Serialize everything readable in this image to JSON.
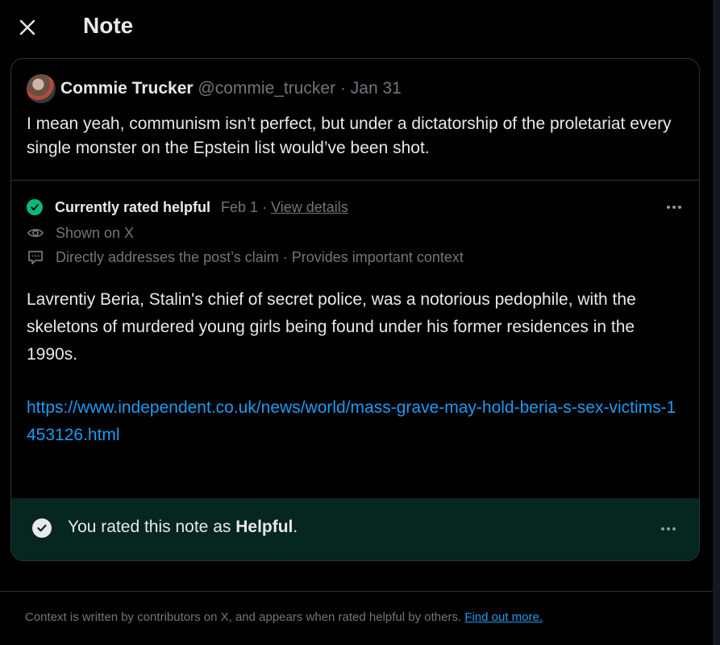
{
  "header": {
    "title": "Note",
    "close_icon": "close-icon"
  },
  "post": {
    "author": "Commie Trucker",
    "handle": "@commie_trucker",
    "separator": "·",
    "date": "Jan 31",
    "text": "I mean yeah, communism isn’t perfect, but under a dictatorship of the proletariat every single monster on the Epstein list would’ve been shot."
  },
  "note": {
    "status_label": "Currently rated helpful",
    "status_date": "Feb 1",
    "separator": "·",
    "view_details": "View details",
    "shown_on": "Shown on X",
    "reasons": "Directly addresses the post’s claim · Provides important context",
    "body": "Lavrentiy Beria, Stalin's chief of secret police, was a notorious pedophile, with the skeletons of murdered young girls being found under his former residences in the 1990s.",
    "link": "https://www.independent.co.uk/news/world/mass-grave-may-hold-beria-s-sex-victims-1453126.html",
    "status_color": "#00ba7c",
    "link_color": "#1d9bf0"
  },
  "rating": {
    "prefix": "You rated this note as ",
    "value": "Helpful",
    "suffix": ".",
    "bar_color": "#062620"
  },
  "footer": {
    "text": "Context is written by contributors on X, and appears when rated helpful by others. ",
    "link": "Find out more."
  }
}
